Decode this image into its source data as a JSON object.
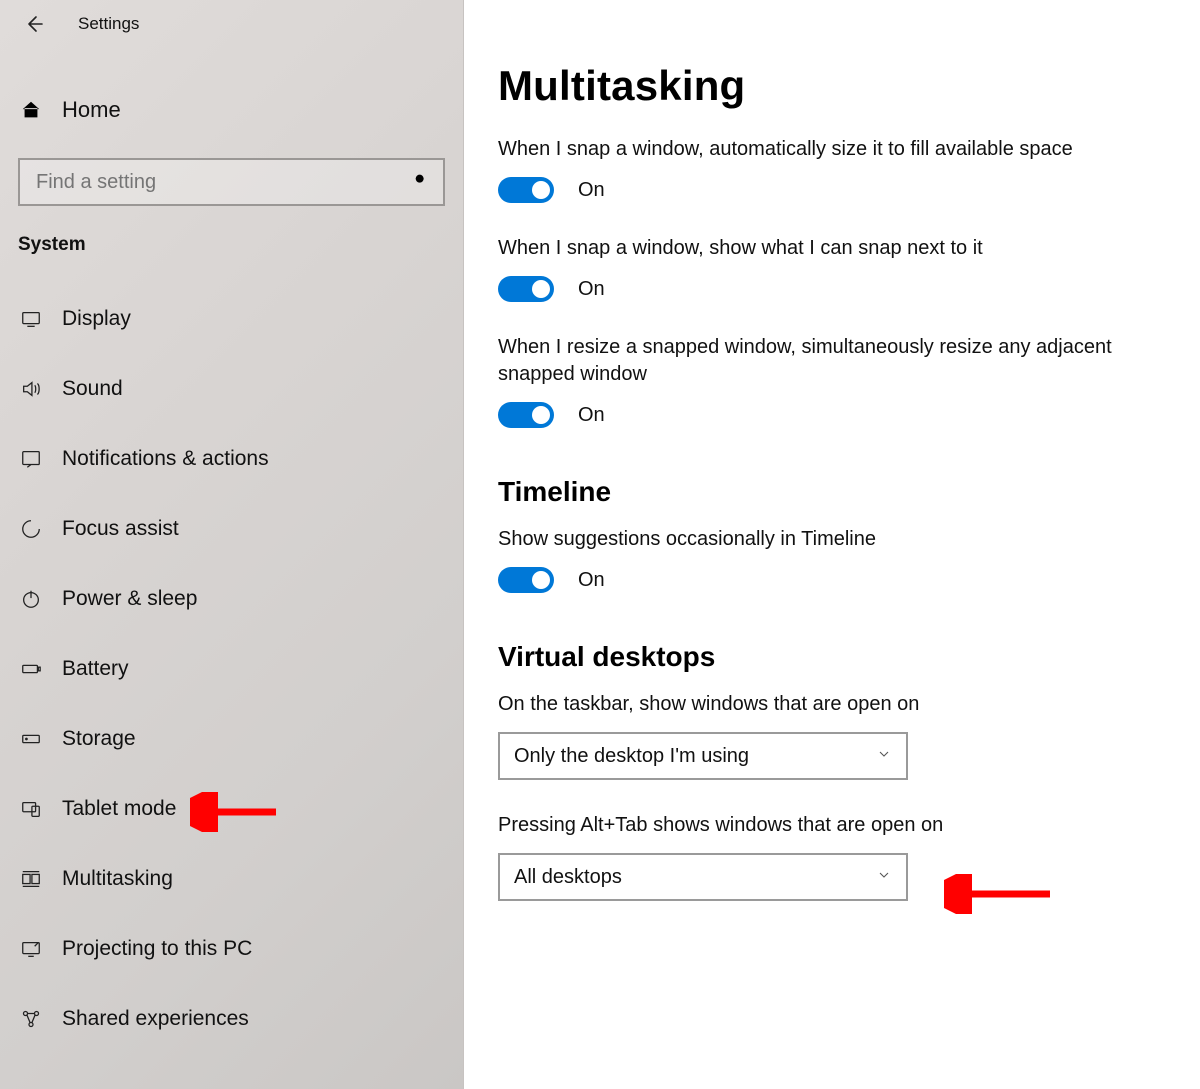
{
  "app_title": "Settings",
  "home_label": "Home",
  "search_placeholder": "Find a setting",
  "category": "System",
  "sidebar_items": [
    {
      "label": "Display"
    },
    {
      "label": "Sound"
    },
    {
      "label": "Notifications & actions"
    },
    {
      "label": "Focus assist"
    },
    {
      "label": "Power & sleep"
    },
    {
      "label": "Battery"
    },
    {
      "label": "Storage"
    },
    {
      "label": "Tablet mode"
    },
    {
      "label": "Multitasking"
    },
    {
      "label": "Projecting to this PC"
    },
    {
      "label": "Shared experiences"
    }
  ],
  "page_title": "Multitasking",
  "snap": {
    "opt1_label": "When I snap a window, automatically size it to fill available space",
    "opt1_state": "On",
    "opt2_label": "When I snap a window, show what I can snap next to it",
    "opt2_state": "On",
    "opt3_label": "When I resize a snapped window, simultaneously resize any adjacent snapped window",
    "opt3_state": "On"
  },
  "timeline": {
    "heading": "Timeline",
    "opt_label": "Show suggestions occasionally in Timeline",
    "opt_state": "On"
  },
  "virtual_desktops": {
    "heading": "Virtual desktops",
    "taskbar_label": "On the taskbar, show windows that are open on",
    "taskbar_value": "Only the desktop I'm using",
    "alttab_label": "Pressing Alt+Tab shows windows that are open on",
    "alttab_value": "All desktops"
  },
  "colors": {
    "accent": "#0078d7",
    "arrow": "#ff0000"
  }
}
